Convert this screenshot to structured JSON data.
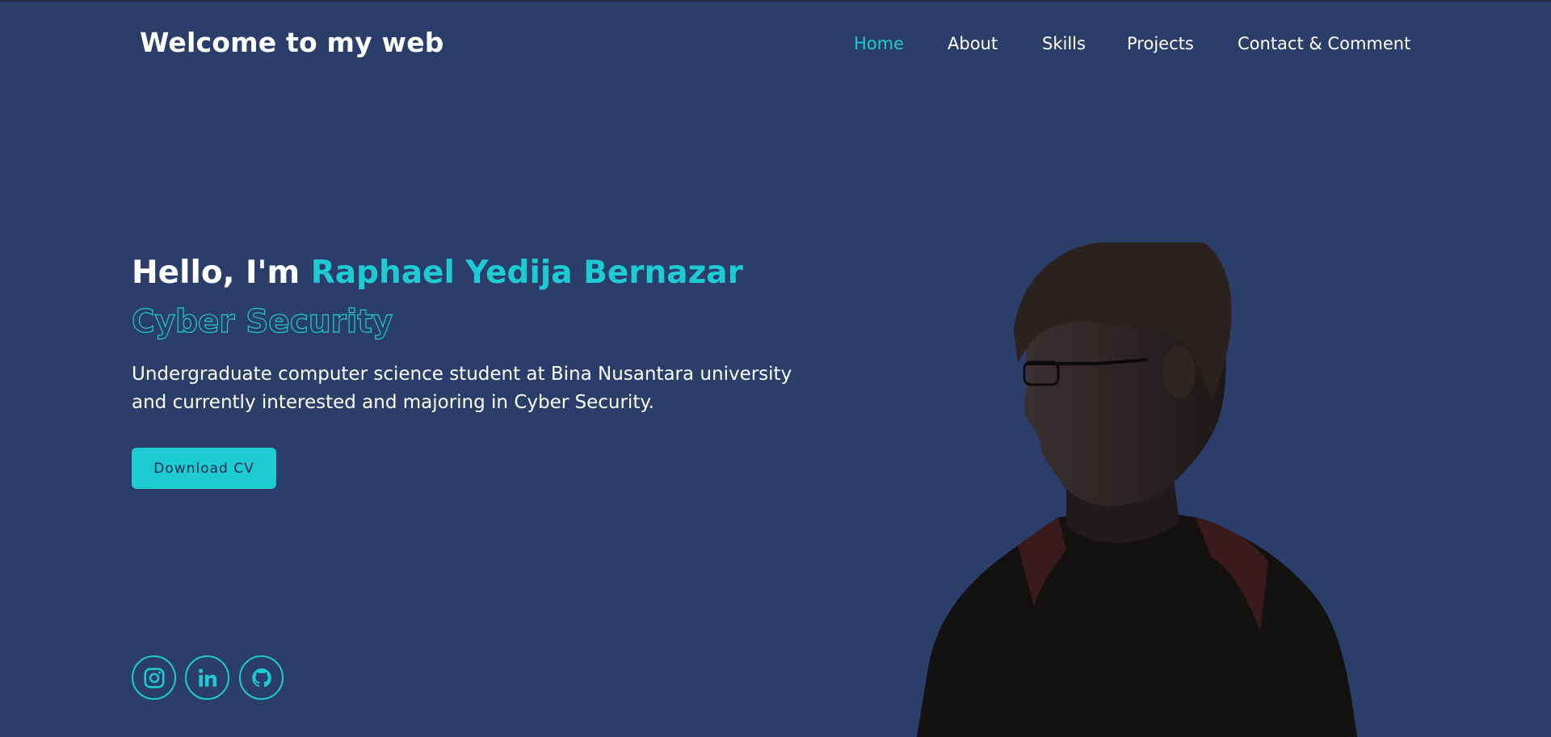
{
  "header": {
    "logo": "Welcome to my web",
    "nav": [
      {
        "label": "Home",
        "active": true
      },
      {
        "label": "About",
        "active": false
      },
      {
        "label": "Skills",
        "active": false
      },
      {
        "label": "Projects",
        "active": false
      },
      {
        "label": "Contact & Comment",
        "active": false
      }
    ]
  },
  "hero": {
    "greeting": "Hello, I'm",
    "name": "Raphael Yedija Bernazar",
    "role": "Cyber Security",
    "description": "Undergraduate computer science student at Bina Nusantara university and currently interested and majoring in Cyber Security.",
    "cv_button": "Download CV"
  },
  "social": [
    {
      "icon": "instagram-icon"
    },
    {
      "icon": "linkedin-icon"
    },
    {
      "icon": "github-icon"
    }
  ],
  "colors": {
    "background": "#2b3e69",
    "accent": "#1ecbd3",
    "text": "#ffffff"
  }
}
